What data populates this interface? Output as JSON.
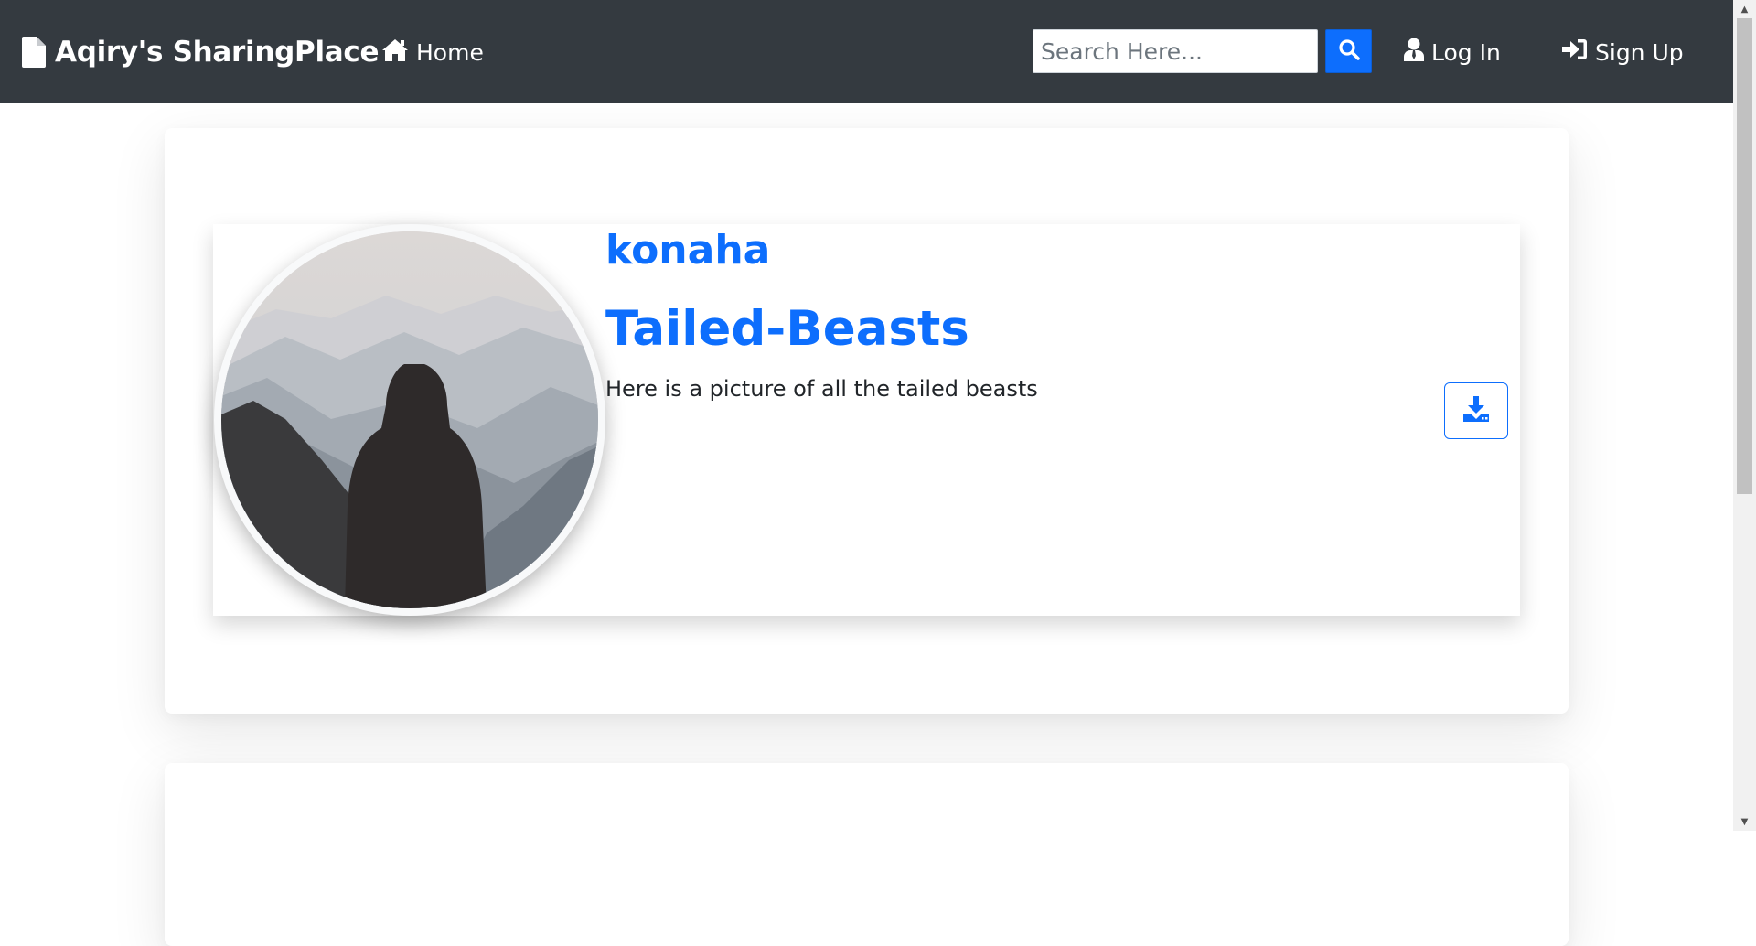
{
  "navbar": {
    "brand": "Aqiry's SharingPlace",
    "brand_icon": "file-icon",
    "home_label": "Home",
    "home_icon": "home-icon",
    "search_placeholder": "Search Here...",
    "search_icon": "search-icon",
    "login_label": "Log In",
    "login_icon": "user-icon",
    "signup_label": "Sign Up",
    "signup_icon": "sign-in-icon"
  },
  "post": {
    "username": "konaha",
    "title": "Tailed-Beasts",
    "description": "Here is a picture of all the tailed beasts",
    "avatar_icon": "profile-avatar",
    "download_icon": "download-icon"
  },
  "colors": {
    "navbar_bg": "#343a40",
    "accent": "#0d6efd",
    "text": "#212529"
  }
}
